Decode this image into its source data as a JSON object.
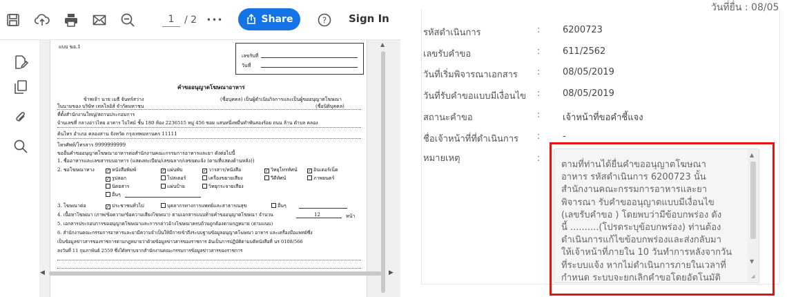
{
  "viewer": {
    "toolbar": {
      "page_current": "1",
      "page_total": "/ 2",
      "more": "•••",
      "share_label": "Share",
      "help": "?",
      "signin_label": "Sign In"
    },
    "sidebar_icons": [
      "edit-pdf-icon",
      "pages-icon",
      "attachment-icon",
      "search-icon"
    ]
  },
  "doc": {
    "form_code": "แบบ ฆอ.1",
    "receipt_no_label": "เลขรับที่",
    "date_label": "วันที่",
    "title": "คำขออนุญาตโฆษณาอาหาร",
    "line1a": "ข้าพเจ้า  นาย เมธี จันทร์สว่าง",
    "line1b": "(ชื่อบุคคล) เป็นผู้ดำเนินกิจการและเป็นผู้ขออนุญาตโฆษณา",
    "line2a": "ในนามของ  บริษัท เทลโลอิส์ จำกัดมหาชน",
    "line2b": "(ชื่อนิติบุคคล)",
    "line3": "ที่ตั้งสำนักงานใหญ่/สถานประกอบการ",
    "line4": "บ้านเลขที่ กลางอ่าวไทย อาคาร ไบไทม์ ชั้น 180 ห้อง 2236515 หมู่ 456 ซอย แสนหนึ่งหมื่นทำพันสองร้อย ถนน ล้าน ตำบล คลอง",
    "line5": "ต้นไทร อำเภอ คลองสาน จังหวัด กรุงเทพมหานคร 11111",
    "line6": "โทรศัพท์/โทรสาร 9999999999",
    "line7": "ขออื่นคำขออนุญาตโฆษณาอาหารต่อสำนักงานคณะกรรมการอาหารและยา ดังต่อไปนี้",
    "line8": "1. ชื่ออาหารและเลขสารบบอาหาร (แสดงทะเบียน/เลขฉลาก/เลขจดแจ้ง (ตามที่แสดงด้านหลัง))",
    "media_label": "2. ชอโฆษณาทาง",
    "media": [
      "หนังสือพิมพ์",
      "แผ่นพับ",
      "วารสาร/หนังสือ",
      "วิทยุโทรทัศน์",
      "อินเตอร์เน็ต",
      "รูปลอก",
      "โปสเตอร์",
      "เครื่องขยายเสียง",
      "วีดีทัศน์",
      "ภาพยนตร์",
      "นิตยสาร",
      "แผ่นป้าย",
      "วิทยุกระจายเสียง",
      "อื่นๆ"
    ],
    "target_label": "3. โฆษณาต่อ",
    "targets": [
      "ประชาชนทั่วไป",
      "บุคลากรทางการแพทย์และสาธารณสุข",
      "อื่นๆ"
    ],
    "line10a": "4. เนื้อหาโฆษณา (ภาพ/ข้อความ/ข้อความเสียงโฆษณา) ตามเอกสารแนบท้ายคำขออนุญาตโฆษณา  จำนวน",
    "line10_count": "12",
    "line10_unit": "หน้า",
    "line11": "5. เอกสารประกอบการขออนุญาตโฆษณาและการกล่าวอ้างโฆษณาครบถ้วนถูกต้องตามกฎหมาย (ตามแนบ)",
    "line12": "6. สำนักงานคณะกรรมการอาหารและยามีความจำเป็นให้มีการเข้าถึงระบบฐานข้อมูลอนุญาตโฆษณา อาหาร และเครื่องมือแพทย์ซึ่ง",
    "line13": "เป็นข้อมูลข่าวสารของราชการตามกฎหมายว่าด้วยข้อมูลข่าวสารของราชการ อันเป็นการปฏิบัติตามมติหนังสือที่ นร 0108/566",
    "line14": "ลงวันที่ 11 กุมภาพันธ์ 2559 ซึ่งได้ทราบจากสำนักงานคณะกรรมการข้อมูลข่าวสารของราชการ"
  },
  "panel": {
    "submit_date": "วันที่ยื่น : 08/05",
    "rows": [
      {
        "label": "รหัสดำเนินการ",
        "colon": ":",
        "value": "6200723"
      },
      {
        "label": "เลขรับคำขอ",
        "colon": ":",
        "value": "611/2562"
      },
      {
        "label": "วันที่เริ่มพิจารณาเอกสาร",
        "colon": ":",
        "value": "08/05/2019"
      },
      {
        "label": "วันที่รับคำขอแบบมีเงื่อนไข",
        "colon": ":",
        "value": "08/05/2019"
      },
      {
        "label": "สถานะคำขอ",
        "colon": ":",
        "value": "เจ้าหน้าที่ขอคำชี้แจง"
      },
      {
        "label": "ชื่อเจ้าหน้าที่ที่ดำเนินการ",
        "colon": ":",
        "value": "-"
      },
      {
        "label": "หมายเหตุ",
        "colon": ":",
        "value": ""
      }
    ],
    "remark": "ตามที่ท่านได้ยื่นคำขออนุญาตโฆษณา\nอาหาร รหัสดำเนินการ 6200723 นั้น\nสำนักงานคณะกรรมการอาหารและยา\nพิจารณา รับคำขออนุญาตแบบมีเงื่อนไข\n(เลขรับคำขอ ) โดยพบว่ามีข้อบกพร่อง ดัง\nนี้ ..........(โปรดระบุข้อบกพร่อง) ท่านต้อง\nดำเนินการแก้ไขข้อบกพร่องและส่งกลับมา\nให้เจ้าหน้าที่ภายใน 10 วันทำการหลังจากวัน\nที่ระบบแจ้ง หากไม่ดำเนินการภายในเวลาที่\nกำหนด ระบบจะยกเลิกคำขอโดยอัตโนมัติ",
    "highlight_color": "#e1140f"
  }
}
